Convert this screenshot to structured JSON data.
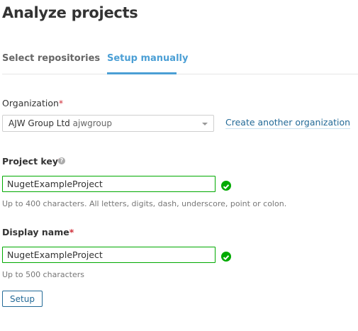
{
  "header": {
    "title": "Analyze projects"
  },
  "tabs": [
    {
      "label": "Select repositories",
      "active": false
    },
    {
      "label": "Setup manually",
      "active": true
    }
  ],
  "organization": {
    "label": "Organization",
    "required_mark": "*",
    "selected_name": "AJW Group Ltd",
    "selected_key": "ajwgroup",
    "create_link": "Create another organization"
  },
  "project_key": {
    "label": "Project key",
    "required_mark": "*",
    "value": "NugetExampleProject",
    "help": "Up to 400 characters. All letters, digits, dash, underscore, point or colon.",
    "help_icon": "?"
  },
  "display_name": {
    "label": "Display name",
    "required_mark": "*",
    "value": "NugetExampleProject",
    "help": "Up to 500 characters"
  },
  "setup_button": "Setup",
  "colors": {
    "accent": "#4b9fd5",
    "valid": "#00aa00",
    "link": "#236a97"
  }
}
